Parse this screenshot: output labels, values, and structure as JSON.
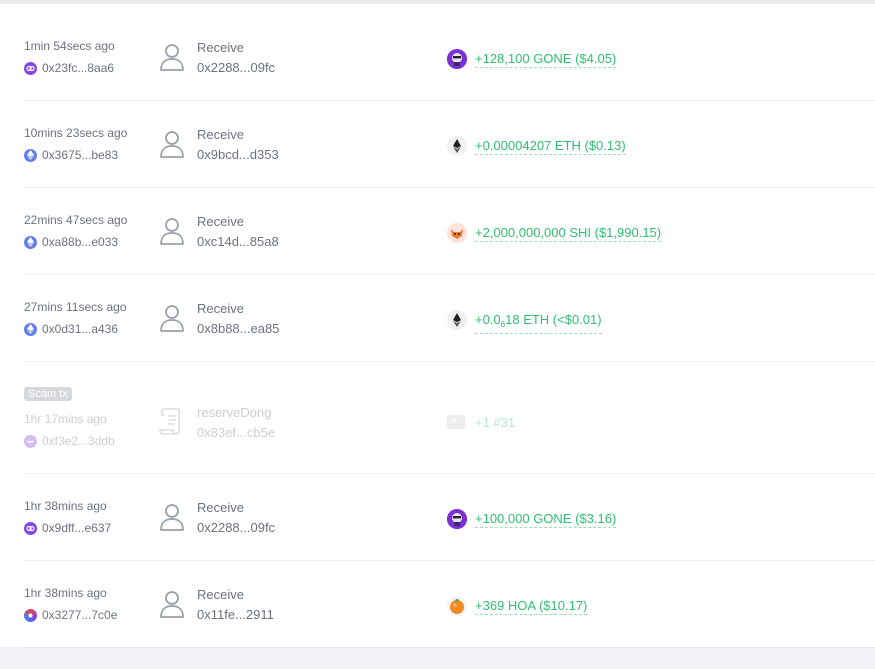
{
  "transactions": [
    {
      "time": "1min 54secs ago",
      "chain": "purple",
      "account": "0x23fc...8aa6",
      "action": "Receive",
      "address": "0x2288...09fc",
      "token_icon": "gone-token-icon",
      "amount": "+128,100 GONE ($4.05)"
    },
    {
      "time": "10mins 23secs ago",
      "chain": "eth",
      "account": "0x3675...be83",
      "action": "Receive",
      "address": "0x9bcd...d353",
      "token_icon": "eth-token-icon",
      "amount": "+0.00004207 ETH ($0.13)"
    },
    {
      "time": "22mins 47secs ago",
      "chain": "eth",
      "account": "0xa88b...e033",
      "action": "Receive",
      "address": "0xc14d...85a8",
      "token_icon": "shi-token-icon",
      "amount": "+2,000,000,000 SHI ($1,990.15)"
    },
    {
      "time": "27mins 11secs ago",
      "chain": "eth",
      "account": "0x0d31...a436",
      "action": "Receive",
      "address": "0x8b88...ea85",
      "token_icon": "eth-token-icon",
      "amount_prefix": "+0.0",
      "amount_sub": "6",
      "amount_suffix": "18 ETH (<$0.01)"
    },
    {
      "scam_label": "Scam tx",
      "time": "1hr 17mins ago",
      "chain": "purple",
      "account": "0xf3e2...3ddb",
      "action": "reserveDong",
      "address": "0x83ef...cb5e",
      "token_icon": "nft-icon",
      "nft_label": "NFT",
      "amount": "+1 #31"
    },
    {
      "time": "1hr 38mins ago",
      "chain": "purple",
      "account": "0x9dff...e637",
      "action": "Receive",
      "address": "0x2288...09fc",
      "token_icon": "gone-token-icon",
      "amount": "+100,000 GONE ($3.16)"
    },
    {
      "time": "1hr 38mins ago",
      "chain": "multi",
      "account": "0x3277...7c0e",
      "action": "Receive",
      "address": "0x11fe...2911",
      "token_icon": "hoa-token-icon",
      "amount": "+369 HOA ($10.17)"
    }
  ],
  "colors": {
    "amount_green": "#2fbf71",
    "text_gray": "#6b7280",
    "eth_blue": "#627eea",
    "purple": "#8247e5"
  }
}
